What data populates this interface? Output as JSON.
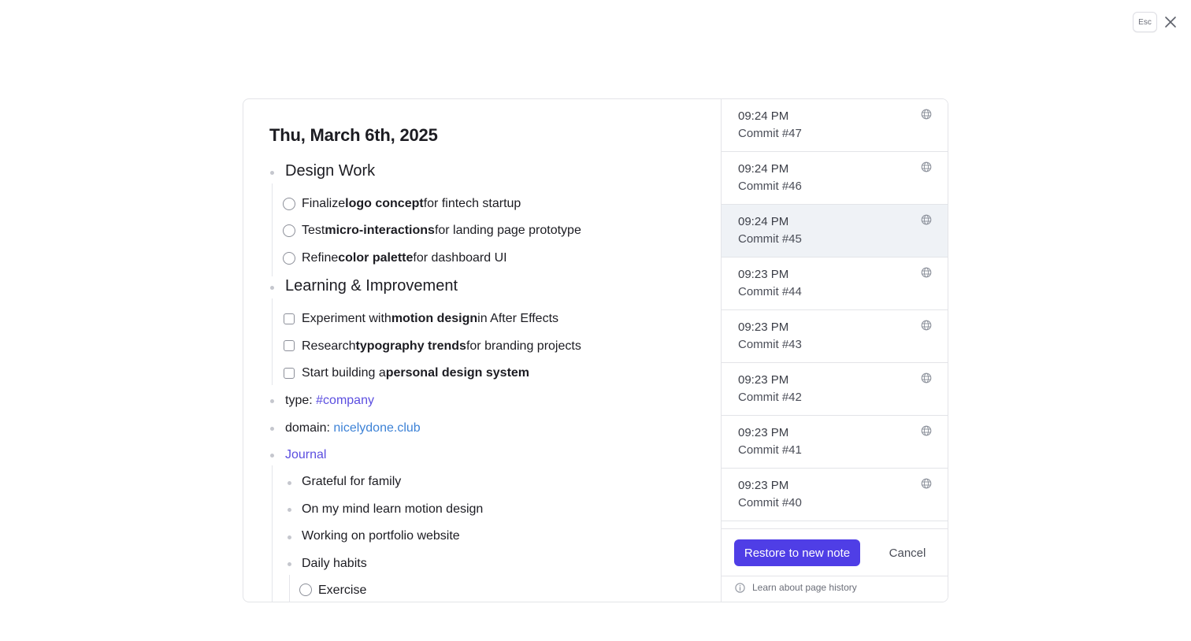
{
  "topbar": {
    "esc_label": "Esc",
    "close_icon": "close-icon"
  },
  "note": {
    "title": "Thu, March 6th, 2025",
    "sections": {
      "design": {
        "heading": "Design Work",
        "tasks": [
          {
            "pre": "Finalize ",
            "bold": "logo concept",
            "post": " for fintech startup"
          },
          {
            "pre": "Test ",
            "bold": "micro-interactions",
            "post": " for landing page prototype"
          },
          {
            "pre": "Refine ",
            "bold": "color palette",
            "post": " for dashboard UI"
          }
        ]
      },
      "learning": {
        "heading": "Learning & Improvement",
        "tasks": [
          {
            "pre": "Experiment with ",
            "bold": "motion design",
            "post": " in After Effects"
          },
          {
            "pre": "Research ",
            "bold": "typography trends",
            "post": " for branding projects"
          },
          {
            "pre": "Start building a ",
            "bold": "personal design system",
            "post": ""
          }
        ]
      }
    },
    "type": {
      "label": "type: ",
      "value": "#company"
    },
    "domain": {
      "label": "domain: ",
      "value": "nicelydone.club"
    },
    "journal": {
      "label": "Journal",
      "items": [
        "Grateful for family",
        "On my mind learn motion design",
        "Working on portfolio website",
        "Daily habits"
      ],
      "habits": [
        "Exercise"
      ]
    }
  },
  "history": {
    "commits": [
      {
        "time": "09:24 PM",
        "label": "Commit #47"
      },
      {
        "time": "09:24 PM",
        "label": "Commit #46"
      },
      {
        "time": "09:24 PM",
        "label": "Commit #45"
      },
      {
        "time": "09:23 PM",
        "label": "Commit #44"
      },
      {
        "time": "09:23 PM",
        "label": "Commit #43"
      },
      {
        "time": "09:23 PM",
        "label": "Commit #42"
      },
      {
        "time": "09:23 PM",
        "label": "Commit #41"
      },
      {
        "time": "09:23 PM",
        "label": "Commit #40"
      }
    ],
    "selected_label": "Commit #45",
    "commit_icon": "globe-icon",
    "restore_label": "Restore to new note",
    "cancel_label": "Cancel",
    "learn_label": "Learn about page history",
    "learn_icon": "info-icon",
    "accent_color": "#4f3ee6"
  }
}
